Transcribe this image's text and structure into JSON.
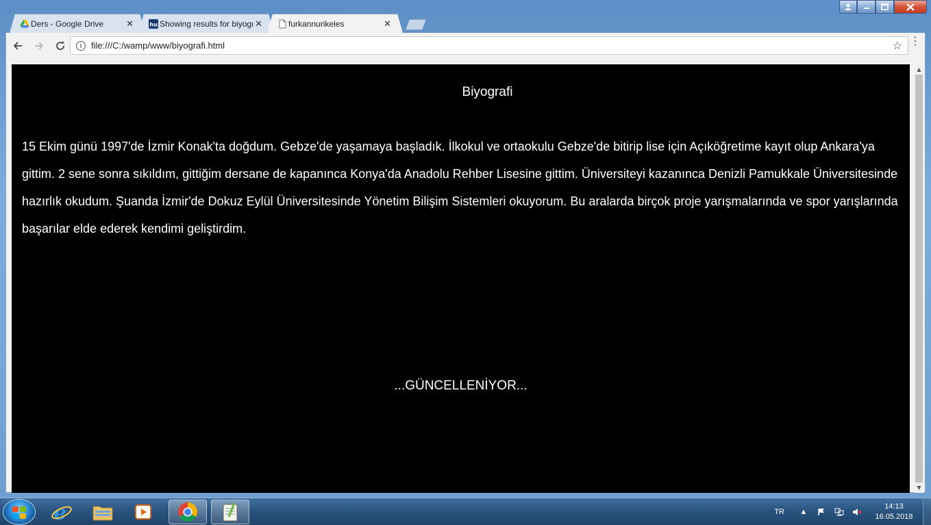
{
  "browser": {
    "tabs": [
      {
        "label": "Ders - Google Drive",
        "icon": "google-drive-icon",
        "active": false
      },
      {
        "label": "Showing results for biyografi",
        "icon": "hu-site-icon",
        "active": false
      },
      {
        "label": "furkannurikeles",
        "icon": "page-icon",
        "active": true
      }
    ],
    "address": "file:///C:/wamp/www/biyografi.html"
  },
  "page": {
    "title": "Biyografi",
    "bio": "15 Ekim günü 1997'de İzmir Konak'ta doğdum. Gebze'de yaşamaya başladık. İlkokul ve ortaokulu Gebze'de bitirip lise için Açıköğretime kayıt olup Ankara'ya gittim. 2 sene sonra sıkıldım, gittiğim dersane de kapanınca Konya'da Anadolu Rehber Lisesine gittim. Üniversiteyi kazanınca Denizli Pamukkale Üniversitesinde hazırlık okudum. Şuanda İzmir'de Dokuz Eylül Üniversitesinde Yönetim Bilişim Sistemleri okuyorum. Bu aralarda birçok proje yarışmalarında ve spor yarışlarında başarılar elde ederek kendimi geliştirdim.",
    "status": "...GÜNCELLENİYOR..."
  },
  "taskbar": {
    "items": [
      "internet-explorer-icon",
      "file-explorer-icon",
      "media-player-icon",
      "chrome-icon",
      "notepad-plus-plus-icon"
    ],
    "language": "TR",
    "time": "14:13",
    "date": "16.05.2018"
  }
}
